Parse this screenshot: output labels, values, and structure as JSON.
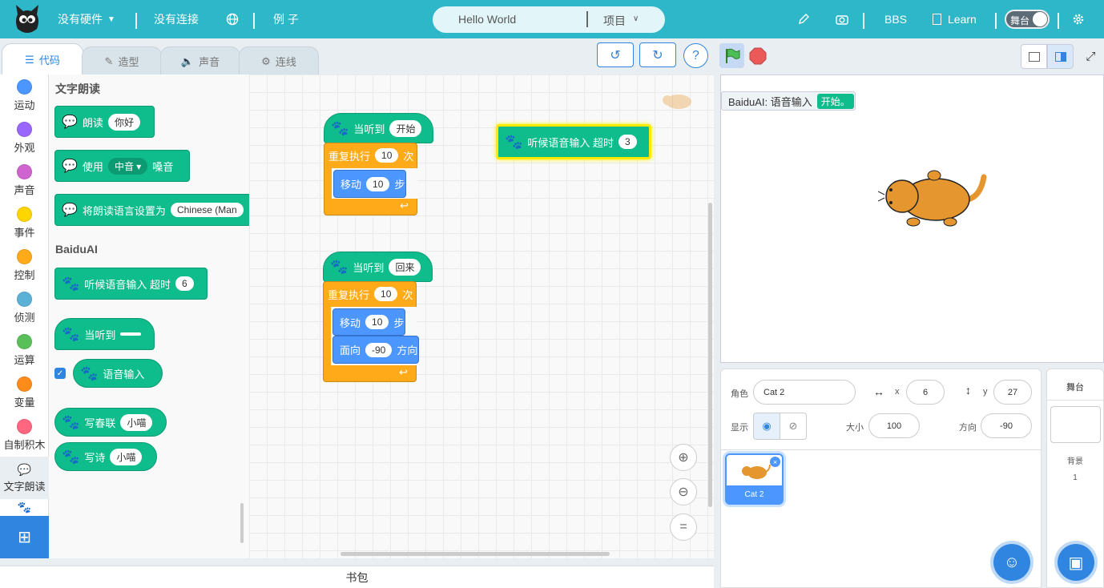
{
  "topbar": {
    "hardware": "没有硬件",
    "connection": "没有连接",
    "examples": "例 子",
    "project_name": "Hello World",
    "project_menu": "项目",
    "bbs": "BBS",
    "learn": "Learn",
    "stage_toggle": "舞台"
  },
  "tabs": {
    "code": "代码",
    "costumes": "造型",
    "sounds": "声音",
    "wiring": "连线"
  },
  "categories": [
    {
      "label": "运动",
      "color": "#4c97ff"
    },
    {
      "label": "外观",
      "color": "#9966ff"
    },
    {
      "label": "声音",
      "color": "#cf63cf"
    },
    {
      "label": "事件",
      "color": "#ffd500"
    },
    {
      "label": "控制",
      "color": "#ffab19"
    },
    {
      "label": "侦测",
      "color": "#5cb1d6"
    },
    {
      "label": "运算",
      "color": "#59c059"
    },
    {
      "label": "变量",
      "color": "#ff8c1a"
    },
    {
      "label": "自制积木",
      "color": "#ff6680"
    },
    {
      "label": "文字朗读",
      "color": "#0fbd8c"
    }
  ],
  "palette": {
    "tts_header": "文字朗读",
    "speak": "朗读",
    "speak_arg": "你好",
    "use_voice": "使用",
    "voice_arg": "中音",
    "voice_suffix": "嗓音",
    "set_lang": "将朗读语言设置为",
    "lang_arg": "Chinese (Man",
    "baidu_header": "BaiduAI",
    "listen_timeout": "听候语音输入 超时",
    "listen_arg": "6",
    "when_hear": "当听到",
    "voice_input": "语音输入",
    "couplet": "写春联",
    "couplet_arg": "小喵",
    "poem": "写诗",
    "poem_arg": "小喵"
  },
  "script1": {
    "hat": "当听到",
    "hat_arg": "开始",
    "repeat": "重复执行",
    "repeat_arg": "10",
    "repeat_unit": "次",
    "move": "移动",
    "move_arg": "10",
    "move_unit": "步"
  },
  "script2": {
    "hat": "当听到",
    "hat_arg": "回来",
    "repeat": "重复执行",
    "repeat_arg": "10",
    "repeat_unit": "次",
    "move": "移动",
    "move_arg": "10",
    "move_unit": "步",
    "point": "面向",
    "point_arg": "-90",
    "point_unit": "方向"
  },
  "script3": {
    "text": "听候语音输入 超时",
    "arg": "3"
  },
  "bag": "书包",
  "monitor": {
    "label": "BaiduAI: 语音输入",
    "value": "开始。"
  },
  "sprite_info": {
    "sprite_label": "角色",
    "sprite_name": "Cat 2",
    "x_label": "x",
    "x": "6",
    "y_label": "y",
    "y": "27",
    "show_label": "显示",
    "size_label": "大小",
    "size": "100",
    "dir_label": "方向",
    "dir": "-90",
    "thumb_name": "Cat 2"
  },
  "stage_info": {
    "title": "舞台",
    "backdrops_label": "背景",
    "backdrops_count": "1"
  },
  "icons": [
    "baidu-paw-icon",
    "speaker-icon",
    "green-flag-icon",
    "stop-icon",
    "settings-icon",
    "globe-icon",
    "pencil-icon",
    "camera-icon",
    "book-icon"
  ]
}
